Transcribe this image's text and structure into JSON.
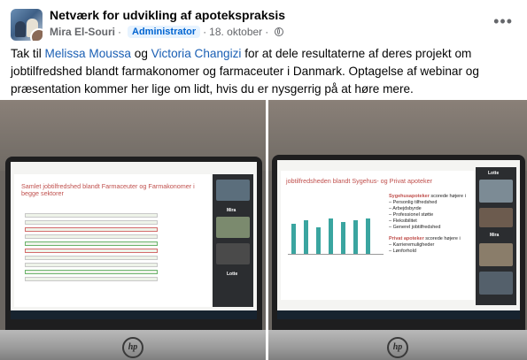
{
  "post": {
    "group_name": "Netværk for udvikling af apotekspraksis",
    "author": "Mira El-Souri",
    "badge": "Administrator",
    "date": "18. oktober",
    "more_icon": "more-options-icon",
    "text_before": "Tak til ",
    "mention1": "Melissa Moussa",
    "text_mid": " og ",
    "mention2": "Victoria Changizi",
    "text_after": " for at dele resultaterne af deres projekt om jobtilfredshed blandt farmakonomer og farmaceuter i Danmark. Optagelse af webinar og præsentation kommer her lige om lidt, hvis du er nysgerrig på at høre mere."
  },
  "photo_left": {
    "slide_title_1": "Samlet jobtilfredshed blandt Farmaceuter og Farmakonomer i",
    "slide_title_2": "begge sektorer",
    "participants": [
      "Mira",
      "Lotte"
    ]
  },
  "photo_right": {
    "slide_title": "jobtilfredsheden blandt Sygehus- og Privat apoteker",
    "bullet1_head": "Sygehusapoteker",
    "bullet1_tail": " scorede højere i",
    "bullet1_items": [
      "Personlig tilfredshed",
      "Arbejdsbyrde",
      "Professionel støtte",
      "Fleksibilitet",
      "Generel jobtilfredshed"
    ],
    "bullet2_head": "Privat apoteker",
    "bullet2_tail": " scorede højere i",
    "bullet2_items": [
      "Karrieremuligheder",
      "Lønforhold"
    ],
    "participants": [
      "Lotte",
      "Mira"
    ]
  },
  "colors": {
    "mention": "#1a5fb4",
    "slide_accent": "#c0504d",
    "bar": "#3aa5a0"
  }
}
